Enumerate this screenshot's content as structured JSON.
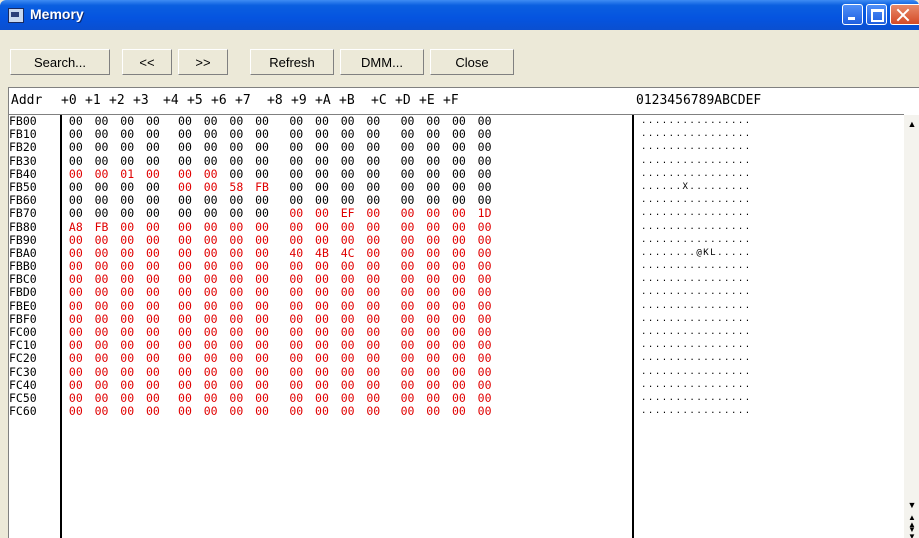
{
  "window": {
    "title": "Memory"
  },
  "toolbar": {
    "buttons": [
      "Search...",
      "<<",
      ">>",
      "Refresh",
      "DMM...",
      "Close"
    ]
  },
  "header": {
    "addr": "Addr",
    "offsets": [
      "+0",
      "+1",
      "+2",
      "+3",
      "+4",
      "+5",
      "+6",
      "+7",
      "+8",
      "+9",
      "+A",
      "+B",
      "+C",
      "+D",
      "+E",
      "+F"
    ],
    "ascii_header": "0123456789ABCDEF"
  },
  "rows": [
    {
      "addr": "FB00",
      "bytes": [
        "00",
        "00",
        "00",
        "00",
        "00",
        "00",
        "00",
        "00",
        "00",
        "00",
        "00",
        "00",
        "00",
        "00",
        "00",
        "00"
      ],
      "changed": [
        0,
        0,
        0,
        0,
        0,
        0,
        0,
        0,
        0,
        0,
        0,
        0,
        0,
        0,
        0,
        0
      ],
      "ascii": "................"
    },
    {
      "addr": "FB10",
      "bytes": [
        "00",
        "00",
        "00",
        "00",
        "00",
        "00",
        "00",
        "00",
        "00",
        "00",
        "00",
        "00",
        "00",
        "00",
        "00",
        "00"
      ],
      "changed": [
        0,
        0,
        0,
        0,
        0,
        0,
        0,
        0,
        0,
        0,
        0,
        0,
        0,
        0,
        0,
        0
      ],
      "ascii": "................"
    },
    {
      "addr": "FB20",
      "bytes": [
        "00",
        "00",
        "00",
        "00",
        "00",
        "00",
        "00",
        "00",
        "00",
        "00",
        "00",
        "00",
        "00",
        "00",
        "00",
        "00"
      ],
      "changed": [
        0,
        0,
        0,
        0,
        0,
        0,
        0,
        0,
        0,
        0,
        0,
        0,
        0,
        0,
        0,
        0
      ],
      "ascii": "................"
    },
    {
      "addr": "FB30",
      "bytes": [
        "00",
        "00",
        "00",
        "00",
        "00",
        "00",
        "00",
        "00",
        "00",
        "00",
        "00",
        "00",
        "00",
        "00",
        "00",
        "00"
      ],
      "changed": [
        0,
        0,
        0,
        0,
        0,
        0,
        0,
        0,
        0,
        0,
        0,
        0,
        0,
        0,
        0,
        0
      ],
      "ascii": "................"
    },
    {
      "addr": "FB40",
      "bytes": [
        "00",
        "00",
        "01",
        "00",
        "00",
        "00",
        "00",
        "00",
        "00",
        "00",
        "00",
        "00",
        "00",
        "00",
        "00",
        "00"
      ],
      "changed": [
        1,
        1,
        1,
        1,
        1,
        1,
        0,
        0,
        0,
        0,
        0,
        0,
        0,
        0,
        0,
        0
      ],
      "ascii": "................"
    },
    {
      "addr": "FB50",
      "bytes": [
        "00",
        "00",
        "00",
        "00",
        "00",
        "00",
        "58",
        "FB",
        "00",
        "00",
        "00",
        "00",
        "00",
        "00",
        "00",
        "00"
      ],
      "changed": [
        0,
        0,
        0,
        0,
        1,
        1,
        1,
        1,
        0,
        0,
        0,
        0,
        0,
        0,
        0,
        0
      ],
      "ascii": "......X........."
    },
    {
      "addr": "FB60",
      "bytes": [
        "00",
        "00",
        "00",
        "00",
        "00",
        "00",
        "00",
        "00",
        "00",
        "00",
        "00",
        "00",
        "00",
        "00",
        "00",
        "00"
      ],
      "changed": [
        0,
        0,
        0,
        0,
        0,
        0,
        0,
        0,
        0,
        0,
        0,
        0,
        0,
        0,
        0,
        0
      ],
      "ascii": "................"
    },
    {
      "addr": "FB70",
      "bytes": [
        "00",
        "00",
        "00",
        "00",
        "00",
        "00",
        "00",
        "00",
        "00",
        "00",
        "EF",
        "00",
        "00",
        "00",
        "00",
        "1D"
      ],
      "changed": [
        0,
        0,
        0,
        0,
        0,
        0,
        0,
        0,
        1,
        1,
        1,
        1,
        1,
        1,
        1,
        1
      ],
      "ascii": "................"
    },
    {
      "addr": "FB80",
      "bytes": [
        "A8",
        "FB",
        "00",
        "00",
        "00",
        "00",
        "00",
        "00",
        "00",
        "00",
        "00",
        "00",
        "00",
        "00",
        "00",
        "00"
      ],
      "changed": [
        1,
        1,
        1,
        1,
        1,
        1,
        1,
        1,
        1,
        1,
        1,
        1,
        1,
        1,
        1,
        1
      ],
      "ascii": "................"
    },
    {
      "addr": "FB90",
      "bytes": [
        "00",
        "00",
        "00",
        "00",
        "00",
        "00",
        "00",
        "00",
        "00",
        "00",
        "00",
        "00",
        "00",
        "00",
        "00",
        "00"
      ],
      "changed": [
        1,
        1,
        1,
        1,
        1,
        1,
        1,
        1,
        1,
        1,
        1,
        1,
        1,
        1,
        1,
        1
      ],
      "ascii": "................"
    },
    {
      "addr": "FBA0",
      "bytes": [
        "00",
        "00",
        "00",
        "00",
        "00",
        "00",
        "00",
        "00",
        "40",
        "4B",
        "4C",
        "00",
        "00",
        "00",
        "00",
        "00"
      ],
      "changed": [
        1,
        1,
        1,
        1,
        1,
        1,
        1,
        1,
        1,
        1,
        1,
        1,
        1,
        1,
        1,
        1
      ],
      "ascii": "........@KL....."
    },
    {
      "addr": "FBB0",
      "bytes": [
        "00",
        "00",
        "00",
        "00",
        "00",
        "00",
        "00",
        "00",
        "00",
        "00",
        "00",
        "00",
        "00",
        "00",
        "00",
        "00"
      ],
      "changed": [
        1,
        1,
        1,
        1,
        1,
        1,
        1,
        1,
        1,
        1,
        1,
        1,
        1,
        1,
        1,
        1
      ],
      "ascii": "................"
    },
    {
      "addr": "FBC0",
      "bytes": [
        "00",
        "00",
        "00",
        "00",
        "00",
        "00",
        "00",
        "00",
        "00",
        "00",
        "00",
        "00",
        "00",
        "00",
        "00",
        "00"
      ],
      "changed": [
        1,
        1,
        1,
        1,
        1,
        1,
        1,
        1,
        1,
        1,
        1,
        1,
        1,
        1,
        1,
        1
      ],
      "ascii": "................"
    },
    {
      "addr": "FBD0",
      "bytes": [
        "00",
        "00",
        "00",
        "00",
        "00",
        "00",
        "00",
        "00",
        "00",
        "00",
        "00",
        "00",
        "00",
        "00",
        "00",
        "00"
      ],
      "changed": [
        1,
        1,
        1,
        1,
        1,
        1,
        1,
        1,
        1,
        1,
        1,
        1,
        1,
        1,
        1,
        1
      ],
      "ascii": "................"
    },
    {
      "addr": "FBE0",
      "bytes": [
        "00",
        "00",
        "00",
        "00",
        "00",
        "00",
        "00",
        "00",
        "00",
        "00",
        "00",
        "00",
        "00",
        "00",
        "00",
        "00"
      ],
      "changed": [
        1,
        1,
        1,
        1,
        1,
        1,
        1,
        1,
        1,
        1,
        1,
        1,
        1,
        1,
        1,
        1
      ],
      "ascii": "................"
    },
    {
      "addr": "FBF0",
      "bytes": [
        "00",
        "00",
        "00",
        "00",
        "00",
        "00",
        "00",
        "00",
        "00",
        "00",
        "00",
        "00",
        "00",
        "00",
        "00",
        "00"
      ],
      "changed": [
        1,
        1,
        1,
        1,
        1,
        1,
        1,
        1,
        1,
        1,
        1,
        1,
        1,
        1,
        1,
        1
      ],
      "ascii": "................"
    },
    {
      "addr": "FC00",
      "bytes": [
        "00",
        "00",
        "00",
        "00",
        "00",
        "00",
        "00",
        "00",
        "00",
        "00",
        "00",
        "00",
        "00",
        "00",
        "00",
        "00"
      ],
      "changed": [
        1,
        1,
        1,
        1,
        1,
        1,
        1,
        1,
        1,
        1,
        1,
        1,
        1,
        1,
        1,
        1
      ],
      "ascii": "................"
    },
    {
      "addr": "FC10",
      "bytes": [
        "00",
        "00",
        "00",
        "00",
        "00",
        "00",
        "00",
        "00",
        "00",
        "00",
        "00",
        "00",
        "00",
        "00",
        "00",
        "00"
      ],
      "changed": [
        1,
        1,
        1,
        1,
        1,
        1,
        1,
        1,
        1,
        1,
        1,
        1,
        1,
        1,
        1,
        1
      ],
      "ascii": "................"
    },
    {
      "addr": "FC20",
      "bytes": [
        "00",
        "00",
        "00",
        "00",
        "00",
        "00",
        "00",
        "00",
        "00",
        "00",
        "00",
        "00",
        "00",
        "00",
        "00",
        "00"
      ],
      "changed": [
        1,
        1,
        1,
        1,
        1,
        1,
        1,
        1,
        1,
        1,
        1,
        1,
        1,
        1,
        1,
        1
      ],
      "ascii": "................"
    },
    {
      "addr": "FC30",
      "bytes": [
        "00",
        "00",
        "00",
        "00",
        "00",
        "00",
        "00",
        "00",
        "00",
        "00",
        "00",
        "00",
        "00",
        "00",
        "00",
        "00"
      ],
      "changed": [
        1,
        1,
        1,
        1,
        1,
        1,
        1,
        1,
        1,
        1,
        1,
        1,
        1,
        1,
        1,
        1
      ],
      "ascii": "................"
    },
    {
      "addr": "FC40",
      "bytes": [
        "00",
        "00",
        "00",
        "00",
        "00",
        "00",
        "00",
        "00",
        "00",
        "00",
        "00",
        "00",
        "00",
        "00",
        "00",
        "00"
      ],
      "changed": [
        1,
        1,
        1,
        1,
        1,
        1,
        1,
        1,
        1,
        1,
        1,
        1,
        1,
        1,
        1,
        1
      ],
      "ascii": "................"
    },
    {
      "addr": "FC50",
      "bytes": [
        "00",
        "00",
        "00",
        "00",
        "00",
        "00",
        "00",
        "00",
        "00",
        "00",
        "00",
        "00",
        "00",
        "00",
        "00",
        "00"
      ],
      "changed": [
        1,
        1,
        1,
        1,
        1,
        1,
        1,
        1,
        1,
        1,
        1,
        1,
        1,
        1,
        1,
        1
      ],
      "ascii": "................"
    },
    {
      "addr": "FC60",
      "bytes": [
        "00",
        "00",
        "00",
        "00",
        "00",
        "00",
        "00",
        "00",
        "00",
        "00",
        "00",
        "00",
        "00",
        "00",
        "00",
        "00"
      ],
      "changed": [
        1,
        1,
        1,
        1,
        1,
        1,
        1,
        1,
        1,
        1,
        1,
        1,
        1,
        1,
        1,
        1
      ],
      "ascii": "................"
    }
  ],
  "colors": {
    "changed": "#e00000",
    "unchanged": "#000000",
    "titlebar": "#0554e0"
  },
  "icons": {
    "window": "memory-window-icon",
    "scroll_up": "scroll-up-arrow-icon",
    "scroll_down": "scroll-down-arrow-icon",
    "page_up": "page-up-icon",
    "page_down": "page-down-icon"
  }
}
